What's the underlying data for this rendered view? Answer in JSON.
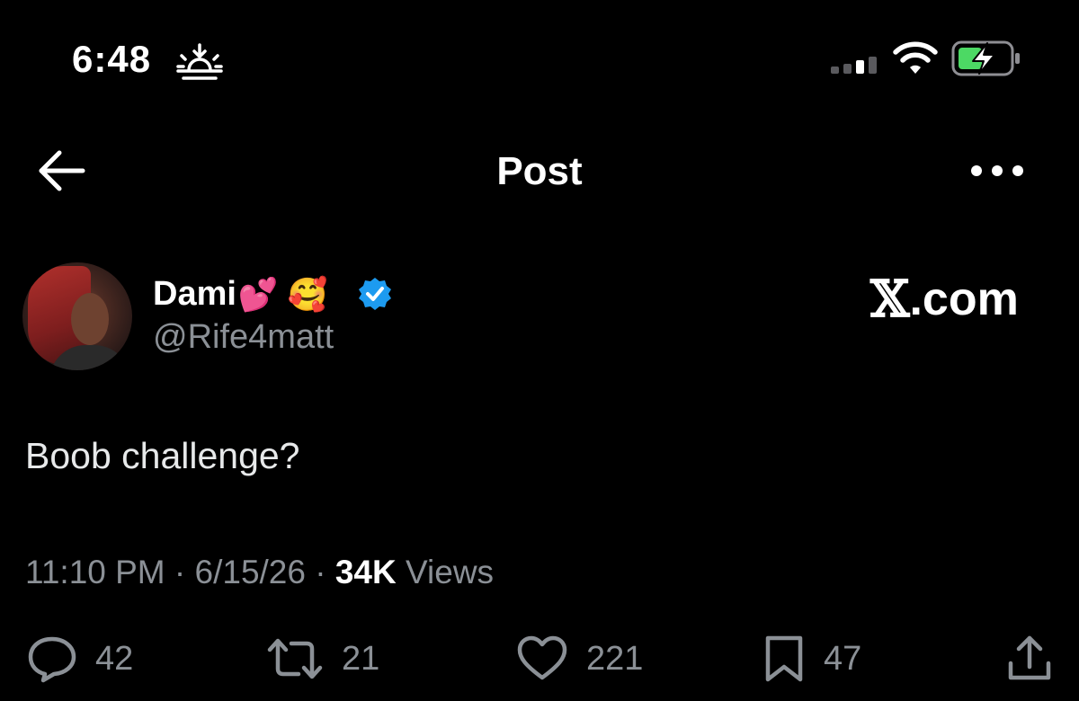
{
  "status_bar": {
    "time": "6:48",
    "status_icon": "sunset-icon",
    "signal_icon": "cellular-signal-icon",
    "wifi_icon": "wifi-icon",
    "battery_icon": "battery-charging-icon",
    "battery_color": "#4cd964"
  },
  "nav": {
    "back_icon": "back-arrow-icon",
    "title": "Post",
    "more_icon": "more-options-icon"
  },
  "author": {
    "display_name": "Dami",
    "name_emojis": "💕 🥰",
    "verified": true,
    "verified_color": "#1d9bf0",
    "handle": "@Rife4matt",
    "avatar_icon": "avatar"
  },
  "brand": {
    "x_mark": "𝕏",
    "text": ".com"
  },
  "post": {
    "text": "Boob challenge?"
  },
  "meta": {
    "time": "11:10 PM",
    "separator": "·",
    "date": "6/15/26",
    "views_count": "34K",
    "views_label": "Views"
  },
  "actions": {
    "reply_count": "42",
    "repost_count": "21",
    "like_count": "221",
    "bookmark_count": "47"
  },
  "colors": {
    "background": "#000000",
    "text_primary": "#e7e9ea",
    "text_secondary": "#8b9096"
  }
}
